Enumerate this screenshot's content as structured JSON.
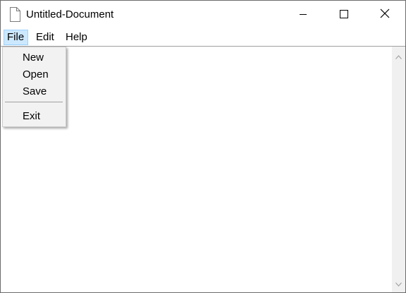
{
  "window": {
    "title": "Untitled-Document",
    "controls": {
      "minimize": "minimize-icon",
      "maximize": "maximize-icon",
      "close": "close-icon"
    }
  },
  "menubar": {
    "items": [
      {
        "label": "File",
        "active": true
      },
      {
        "label": "Edit"
      },
      {
        "label": "Help"
      }
    ]
  },
  "file_menu": {
    "items": [
      {
        "label": "New"
      },
      {
        "label": "Open"
      },
      {
        "label": "Save"
      },
      {
        "label": "Exit"
      }
    ]
  },
  "editor": {
    "content": ""
  },
  "colors": {
    "menu_highlight": "#cce8ff",
    "menu_highlight_border": "#99d1ff",
    "dropdown_bg": "#f2f2f2"
  }
}
